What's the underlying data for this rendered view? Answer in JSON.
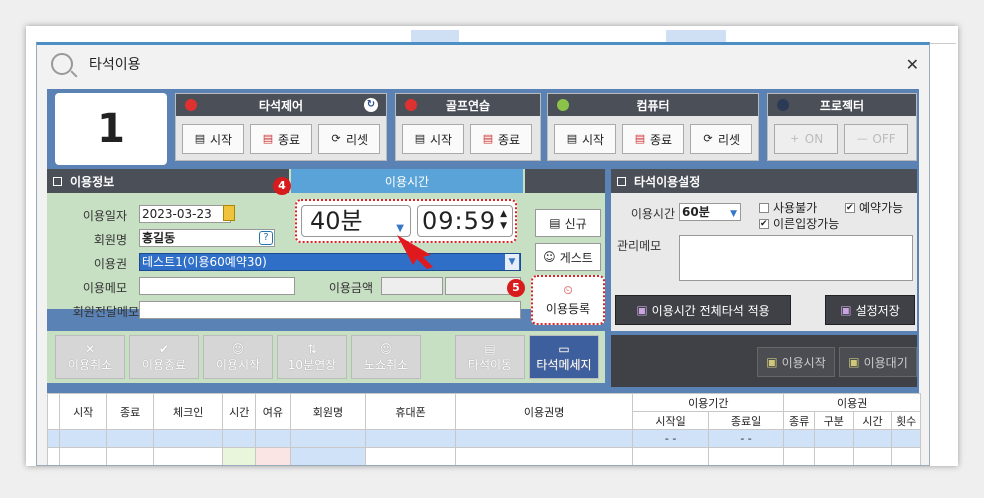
{
  "dialog": {
    "title": "타석이용",
    "close": "✕"
  },
  "seat_number": "1",
  "groups": [
    {
      "name": "타석제어",
      "dot_color": "#e03131",
      "buttons": [
        "시작",
        "종료",
        "리셋"
      ]
    },
    {
      "name": "골프연습",
      "dot_color": "#e03131",
      "buttons": [
        "시작",
        "종료"
      ]
    },
    {
      "name": "컴퓨터",
      "dot_color": "#8bc34a",
      "buttons": [
        "시작",
        "종료",
        "리셋"
      ]
    },
    {
      "name": "프로젝터",
      "dot_color": "#2b3a55",
      "buttons": [
        "ON",
        "OFF"
      ]
    }
  ],
  "usage_info": {
    "header": "이용정보",
    "time_header": "이용시간",
    "date_label": "이용일자",
    "date_value": "2023-03-23",
    "member_label": "회원명",
    "member_value": "홍길동",
    "pass_label": "이용권",
    "pass_value": "테스트1(이용60예약30)",
    "memo_label": "이용메모",
    "amount_label": "이용금액",
    "deliver_memo_label": "회원전달메모",
    "minutes": "40분",
    "hour": "09",
    "minute": "59",
    "new_button": "신규",
    "guest_button": "게스트",
    "register_button": "이용등록",
    "badge_4": "4",
    "badge_5": "5"
  },
  "settings": {
    "header": "타석이용설정",
    "time_label": "이용시간",
    "time_value": "60분",
    "unusable": "사용불가",
    "reservable": "예약가능",
    "early_entry": "이른입장가능",
    "admin_memo_label": "관리메모",
    "apply_all_button": "이용시간 전체타석 적용",
    "save_button": "설정저장"
  },
  "actions": [
    "이용취소",
    "이용종료",
    "이용시작",
    "10분연장",
    "노쇼취소",
    "타석이동",
    "타석메세지"
  ],
  "right_actions": [
    "이용시작",
    "이용대기"
  ],
  "table": {
    "headers": [
      "시작",
      "종료",
      "체크인",
      "시간",
      "여유",
      "회원명",
      "휴대폰",
      "이용권명"
    ],
    "group1": "이용기간",
    "group1_sub": [
      "시작일",
      "종료일"
    ],
    "group2": "이용권",
    "group2_sub": [
      "종류",
      "구분",
      "시간",
      "횟수"
    ],
    "row_dates": [
      "- -",
      "- -"
    ]
  }
}
